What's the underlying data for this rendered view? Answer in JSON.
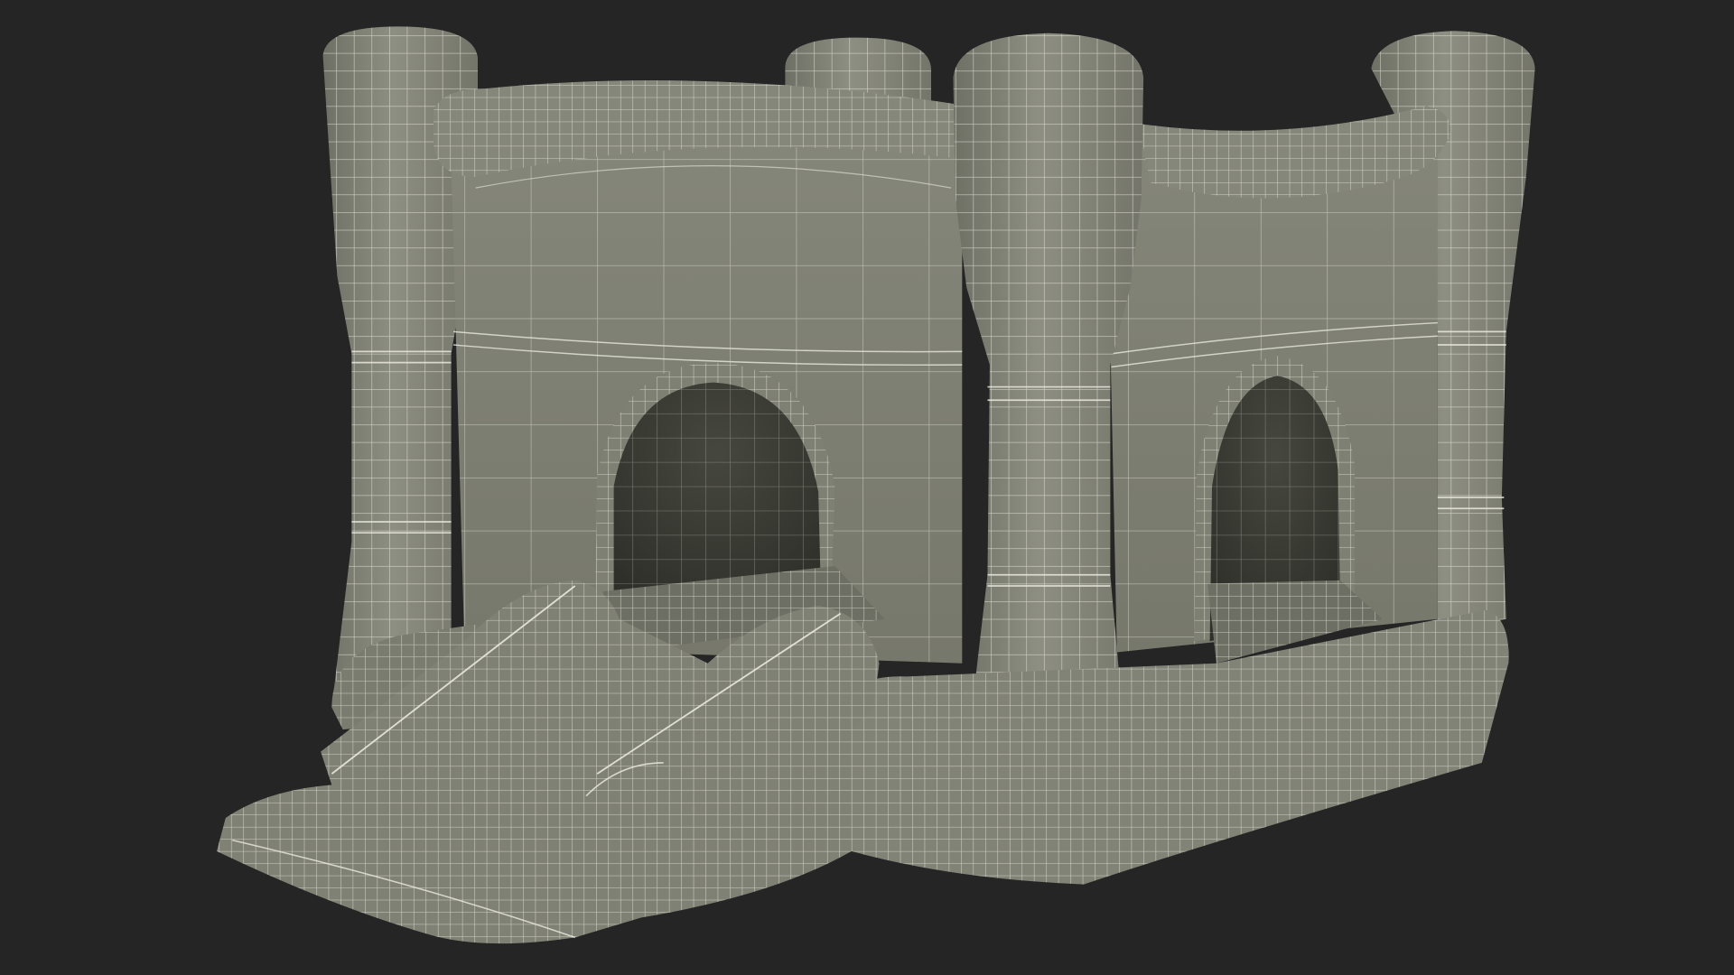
{
  "scene": {
    "subject": "inflatable-bounce-castle-wireframe",
    "colors": {
      "background": "#252525",
      "surface": "#7e7f73",
      "surface_light": "#8b8c80",
      "surface_dark": "#6c6d62",
      "interior": "#3b3c34",
      "wire": "#e9e8df"
    }
  }
}
